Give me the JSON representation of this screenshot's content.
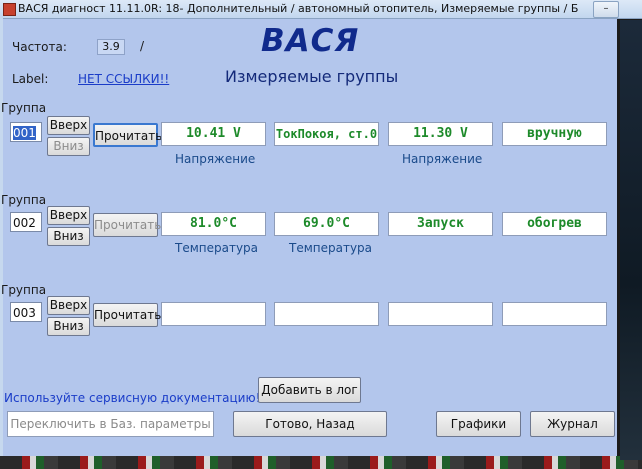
{
  "window": {
    "title": "ВАСЯ диагност 11.11.0R: 18- Дополнительный / автономный отопитель,  Измеряемые группы / Базо...",
    "minimize_symbol": "–"
  },
  "header": {
    "frequency_label": "Частота:",
    "frequency_value": "3.9",
    "frequency_suffix": "/",
    "label_caption": "Label:",
    "label_link": "НЕТ ССЫЛКИ!!",
    "brand": "ВАСЯ",
    "subtitle": "Измеряемые группы"
  },
  "groups": [
    {
      "label": "Группа",
      "number": "001",
      "up": "Вверх",
      "down": "Вниз",
      "read": "Прочитать",
      "values": [
        "10.41 V",
        "ТокПокоя, ст.0",
        "11.30 V",
        "вручную"
      ],
      "units": [
        "Напряжение",
        "",
        "Напряжение",
        ""
      ]
    },
    {
      "label": "Группа",
      "number": "002",
      "up": "Вверх",
      "down": "Вниз",
      "read": "Прочитать",
      "values": [
        "81.0°C",
        "69.0°C",
        "Запуск",
        "обогрев"
      ],
      "units": [
        "Температура",
        "Температура",
        "",
        ""
      ]
    },
    {
      "label": "Группа",
      "number": "003",
      "up": "Вверх",
      "down": "Вниз",
      "read": "Прочитать",
      "values": [
        "",
        "",
        "",
        ""
      ],
      "units": [
        "",
        "",
        "",
        ""
      ]
    }
  ],
  "footer": {
    "hint": "Используйте сервисную документацию!",
    "add_log": "Добавить в лог",
    "switch_basic": "Переключить в Баз. параметры",
    "done_back": "Готово, Назад",
    "graphs": "Графики",
    "journal": "Журнал"
  },
  "colors": {
    "background": "#b3c6ec",
    "value_text": "#1d8a2a",
    "brand_text": "#102a8c"
  }
}
